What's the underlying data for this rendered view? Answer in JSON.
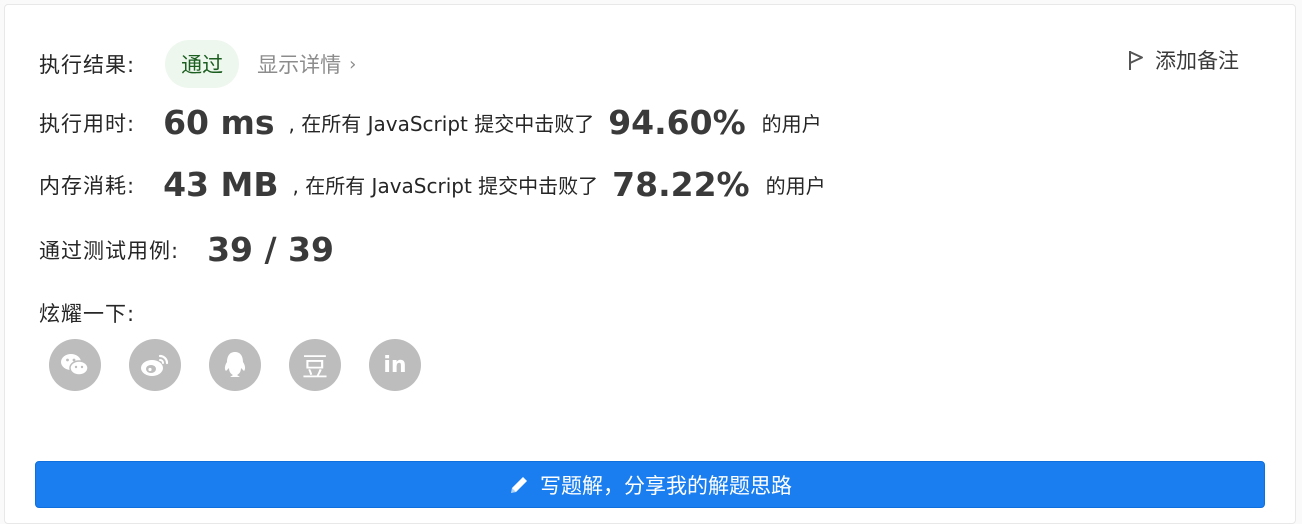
{
  "result": {
    "label": "执行结果:",
    "status": "通过",
    "details_link": "显示详情",
    "details_chevron": "›",
    "add_note": "添加备注"
  },
  "runtime": {
    "label": "执行用时:",
    "value": "60 ms",
    "mid_text": ", 在所有 JavaScript 提交中击败了",
    "percent": "94.60%",
    "suffix": "的用户"
  },
  "memory": {
    "label": "内存消耗:",
    "value": "43 MB",
    "mid_text": ", 在所有 JavaScript 提交中击败了",
    "percent": "78.22%",
    "suffix": "的用户"
  },
  "tests": {
    "label": "通过测试用例:",
    "value": "39 / 39"
  },
  "share": {
    "label": "炫耀一下:",
    "icons": [
      "wechat-icon",
      "weibo-icon",
      "qq-icon",
      "douban-icon",
      "linkedin-icon"
    ],
    "douban_glyph": "豆",
    "linkedin_glyph": "in"
  },
  "write_solution": {
    "label": "写题解，分享我的解题思路"
  },
  "colors": {
    "accent": "#1a7ef0",
    "pass_bg": "#edf7ee",
    "pass_text": "#1b5e20",
    "icon_gray": "#bdbdbd"
  }
}
